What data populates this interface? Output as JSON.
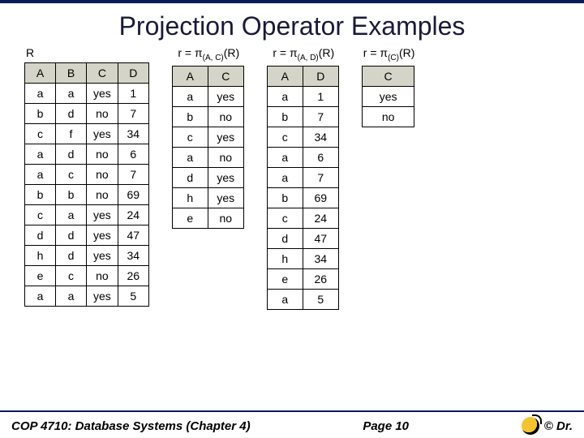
{
  "title": "Projection Operator Examples",
  "relations": {
    "R": {
      "label_html": "R",
      "headers": [
        "A",
        "B",
        "C",
        "D"
      ],
      "rows": [
        [
          "a",
          "a",
          "yes",
          "1"
        ],
        [
          "b",
          "d",
          "no",
          "7"
        ],
        [
          "c",
          "f",
          "yes",
          "34"
        ],
        [
          "a",
          "d",
          "no",
          "6"
        ],
        [
          "a",
          "c",
          "no",
          "7"
        ],
        [
          "b",
          "b",
          "no",
          "69"
        ],
        [
          "c",
          "a",
          "yes",
          "24"
        ],
        [
          "d",
          "d",
          "yes",
          "47"
        ],
        [
          "h",
          "d",
          "yes",
          "34"
        ],
        [
          "e",
          "c",
          "no",
          "26"
        ],
        [
          "a",
          "a",
          "yes",
          "5"
        ]
      ]
    },
    "AC": {
      "label_html": "r = π<sub>(A, C)</sub>(R)",
      "headers": [
        "A",
        "C"
      ],
      "rows": [
        [
          "a",
          "yes"
        ],
        [
          "b",
          "no"
        ],
        [
          "c",
          "yes"
        ],
        [
          "a",
          "no"
        ],
        [
          "d",
          "yes"
        ],
        [
          "h",
          "yes"
        ],
        [
          "e",
          "no"
        ]
      ]
    },
    "AD": {
      "label_html": "r = π<sub>(A, D)</sub>(R)",
      "headers": [
        "A",
        "D"
      ],
      "rows": [
        [
          "a",
          "1"
        ],
        [
          "b",
          "7"
        ],
        [
          "c",
          "34"
        ],
        [
          "a",
          "6"
        ],
        [
          "a",
          "7"
        ],
        [
          "b",
          "69"
        ],
        [
          "c",
          "24"
        ],
        [
          "d",
          "47"
        ],
        [
          "h",
          "34"
        ],
        [
          "e",
          "26"
        ],
        [
          "a",
          "5"
        ]
      ]
    },
    "C": {
      "label_html": "r = π<sub>(C)</sub>(R)",
      "headers": [
        "C"
      ],
      "rows": [
        [
          "yes"
        ],
        [
          "no"
        ]
      ]
    }
  },
  "footer": {
    "left": "COP 4710: Database Systems  (Chapter 4)",
    "center": "Page 10",
    "right": "© Dr."
  }
}
